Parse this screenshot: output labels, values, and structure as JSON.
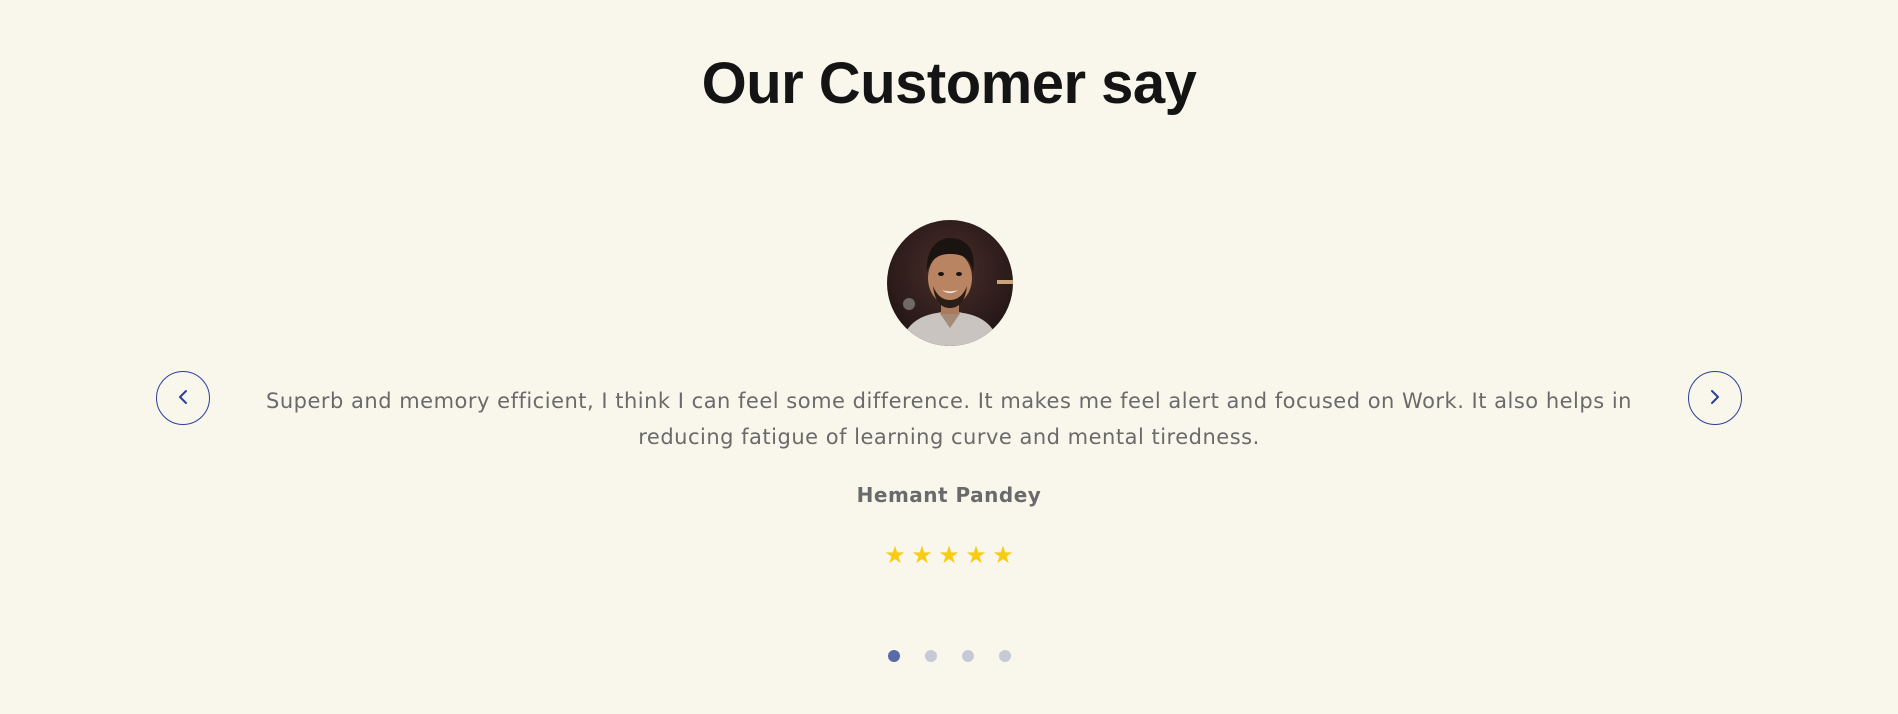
{
  "section": {
    "title": "Our Customer say"
  },
  "testimonial": {
    "quote": "Superb and memory efficient, I think I can feel some difference. It makes me feel alert and focused on Work. It also helps in reducing fatigue of learning curve and mental tiredness.",
    "author": "Hemant Pandey",
    "rating": 5,
    "rating_max": 5
  },
  "carousel": {
    "prev_icon": "chevron-left-icon",
    "next_icon": "chevron-right-icon",
    "slide_count": 4,
    "active_index": 0
  },
  "colors": {
    "background": "#f9f7ec",
    "title": "#141414",
    "body_text": "#6a6a6a",
    "accent": "#2b3f99",
    "star": "#f7cc12",
    "dot_active": "#5a6aa8",
    "dot_inactive": "#c6c9d6"
  }
}
